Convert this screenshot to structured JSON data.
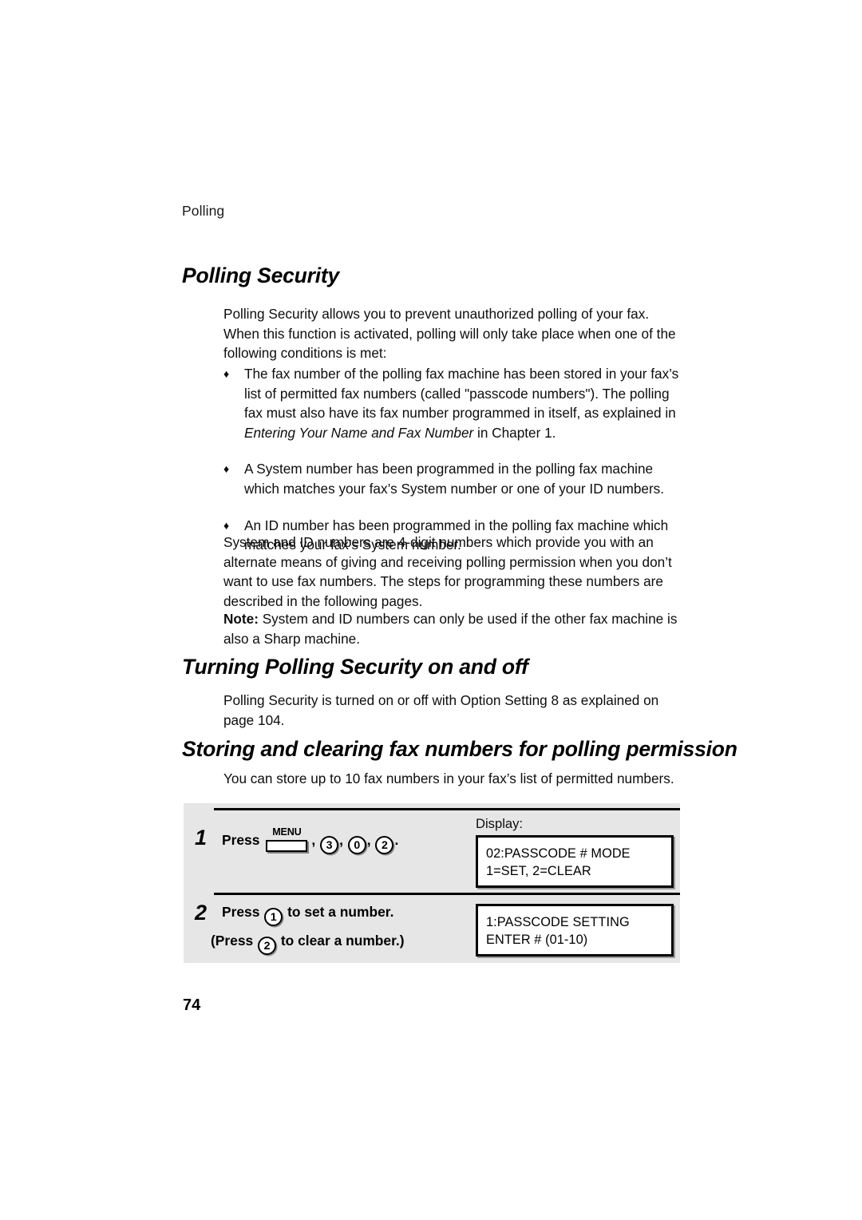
{
  "page": {
    "running_header": "Polling",
    "folio": "74"
  },
  "headings": {
    "polling_security": "Polling Security",
    "turning_on_off": "Turning Polling Security on and off",
    "storing_clearing": "Storing and clearing fax numbers for polling permission"
  },
  "body": {
    "intro": "Polling Security allows you to prevent unauthorized polling of your fax. When this function is activated, polling will only take place when one of the following conditions is met:",
    "system_id_paragraph": "System and ID numbers are 4-digit numbers which provide you with an alternate means of giving and receiving polling permission when you don’t want to use fax numbers. The steps for programming these numbers are described in the following pages.",
    "note_label": "Note:",
    "note_text": " System and ID numbers can only be used if the other fax machine is also a Sharp machine.",
    "option_setting": "Polling Security is turned on or off with Option Setting 8 as explained on page 104.",
    "store_up_to": "You can store up to 10 fax numbers in your fax’s list of permitted numbers."
  },
  "bullets": [
    {
      "marker": "♦",
      "text_before_italic": "The fax number of the polling fax machine has been stored in your fax’s list of permitted fax numbers (called \"passcode numbers\"). The polling fax must also have its fax number programmed in itself, as explained in ",
      "italic_text": "Entering Your Name and Fax Number",
      "text_after_italic": " in Chapter 1."
    },
    {
      "marker": "♦",
      "text_before_italic": "A System number has been programmed in the polling fax machine which matches your fax’s System number or one of your ID numbers.",
      "italic_text": "",
      "text_after_italic": ""
    },
    {
      "marker": "♦",
      "text_before_italic": "An ID number has been programmed in the polling fax machine which matches your fax’s System number.",
      "italic_text": "",
      "text_after_italic": ""
    }
  ],
  "steps": {
    "display_label": "Display:",
    "step1": {
      "number": "1",
      "press_word": "Press",
      "menu_key_label": "MENU",
      "comma_1": ",",
      "key_3": "3",
      "comma_2": ",",
      "key_0": "0",
      "comma_3": ",",
      "key_2": "2",
      "period": ".",
      "display_line_1": "02:PASSCODE # MODE",
      "display_line_2": "1=SET, 2=CLEAR"
    },
    "step2": {
      "number": "2",
      "press_word": "Press",
      "key_1": "1",
      "set_text": "to set a number.",
      "paren_press": "(Press",
      "key_2": "2",
      "clear_text": "to clear a number.)",
      "display_line_1": "1:PASSCODE SETTING",
      "display_line_2": "ENTER # (01-10)"
    }
  },
  "colors": {
    "panel_background": "#e6e6e6",
    "text": "#000000",
    "page_background": "#ffffff"
  }
}
